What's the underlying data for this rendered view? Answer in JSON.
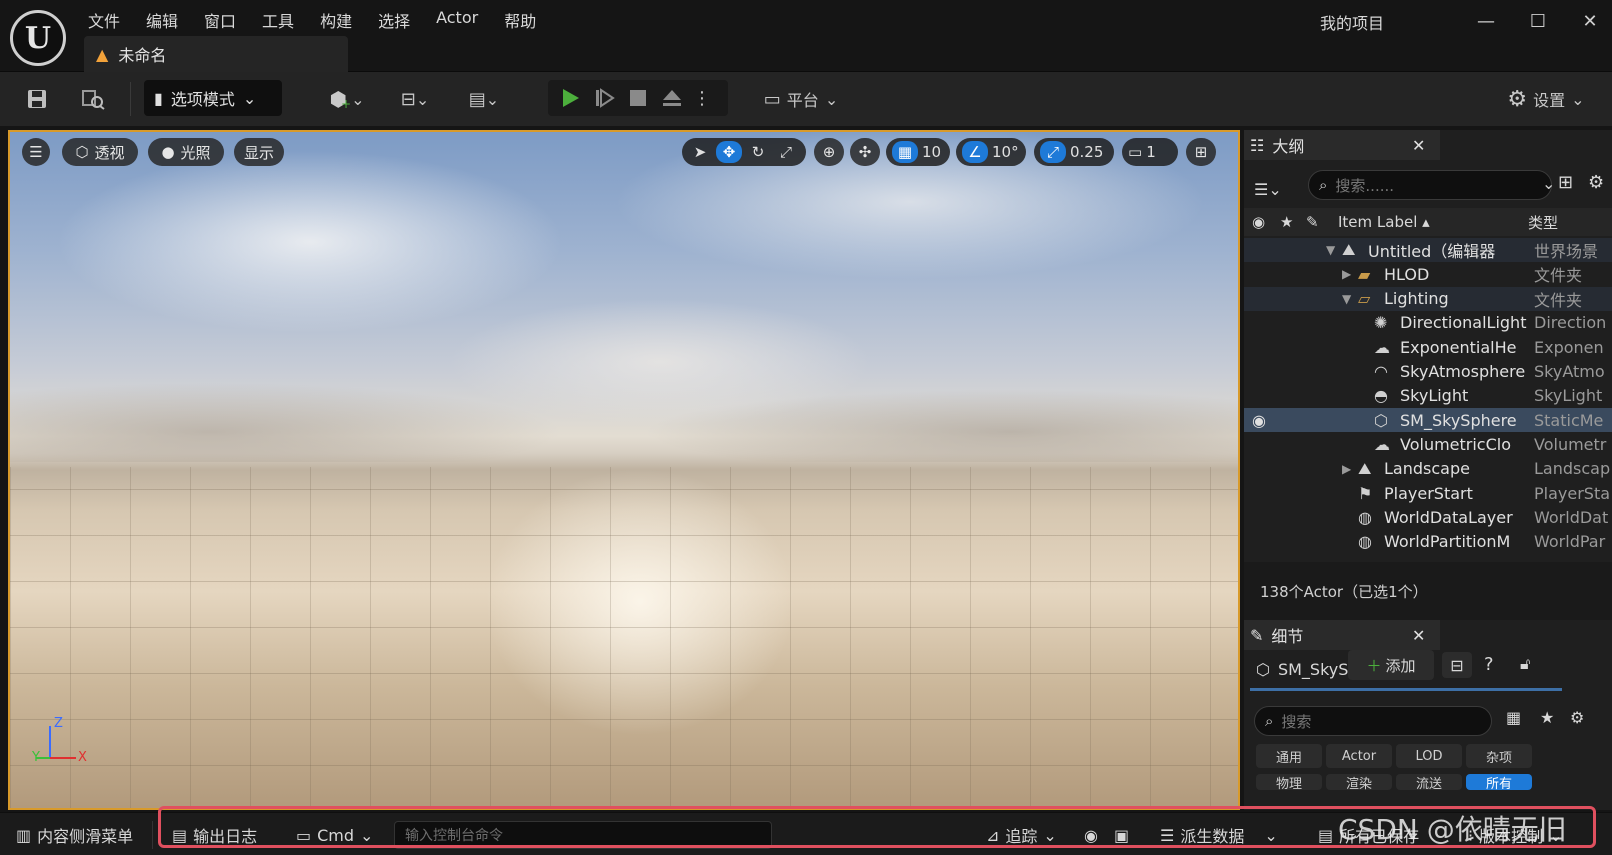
{
  "app": {
    "logo_text": "U",
    "project_name": "我的项目"
  },
  "menu": [
    "文件",
    "编辑",
    "窗口",
    "工具",
    "构建",
    "选择",
    "Actor",
    "帮助"
  ],
  "window_controls": {
    "minimize": "—",
    "maximize": "☐",
    "close": "✕"
  },
  "document_tab": {
    "title": "未命名",
    "icon": "level-warning-icon"
  },
  "toolbar": {
    "mode_button": "选项模式",
    "platform_button": "平台",
    "settings_button": "设置"
  },
  "viewport": {
    "perspective_label": "透视",
    "lighting_label": "光照",
    "show_label": "显示",
    "grid_snap_value": "10",
    "rotation_snap_value": "10°",
    "scale_snap_value": "0.25",
    "camera_speed_value": "1",
    "axis": {
      "z": "Z",
      "y": "Y",
      "x": "X"
    }
  },
  "outliner": {
    "title": "大纲",
    "search_placeholder": "搜索......",
    "columns": {
      "label": "Item Label ▴",
      "type": "类型"
    },
    "rows": [
      {
        "name": "Untitled（编辑器",
        "type": "世界场景",
        "icon": "world-icon",
        "expander": "down"
      },
      {
        "name": "HLOD",
        "type": "文件夹",
        "icon": "folder-icon",
        "expander": "right"
      },
      {
        "name": "Lighting",
        "type": "文件夹",
        "icon": "folder-open-icon",
        "expander": "down"
      },
      {
        "name": "DirectionalLight",
        "type": "Direction",
        "icon": "directional-light-icon"
      },
      {
        "name": "ExponentialHe",
        "type": "Exponen",
        "icon": "fog-icon"
      },
      {
        "name": "SkyAtmosphere",
        "type": "SkyAtmo",
        "icon": "sky-atmosphere-icon"
      },
      {
        "name": "SkyLight",
        "type": "SkyLight",
        "icon": "skylight-icon"
      },
      {
        "name": "SM_SkySphere",
        "type": "StaticMe",
        "icon": "static-mesh-icon"
      },
      {
        "name": "VolumetricClo",
        "type": "Volumetr",
        "icon": "cloud-icon"
      },
      {
        "name": "Landscape",
        "type": "Landscap",
        "icon": "landscape-icon",
        "expander": "right"
      },
      {
        "name": "PlayerStart",
        "type": "PlayerSta",
        "icon": "player-start-icon"
      },
      {
        "name": "WorldDataLayer",
        "type": "WorldDat",
        "icon": "world-data-layer-icon"
      },
      {
        "name": "WorldPartitionM",
        "type": "WorldPar",
        "icon": "world-partition-icon"
      }
    ],
    "footer": "138个Actor（已选1个）"
  },
  "details": {
    "title": "细节",
    "selected_name": "SM_SkySph",
    "add_button": "添加",
    "search_placeholder": "搜索",
    "filter_chips": [
      "通用",
      "Actor",
      "LOD",
      "杂项"
    ],
    "filter_chips_row2": [
      "物理",
      "渲染",
      "流送",
      "所有"
    ]
  },
  "statusbar": {
    "content_drawer": "内容侧滑菜单",
    "output_log": "输出日志",
    "cmd": "Cmd",
    "console_placeholder": "输入控制台命令",
    "trace": "追踪",
    "derived_data": "派生数据",
    "save_all": "所有已保存",
    "source_control": "版本控制"
  },
  "watermark": "CSDN @依晴无旧",
  "colors": {
    "accent": "#1e7ad8",
    "play_green": "#4caf3c",
    "selection": "#3a4a5e",
    "highlight_box": "#e0505f",
    "viewport_border": "#d89a2a"
  }
}
